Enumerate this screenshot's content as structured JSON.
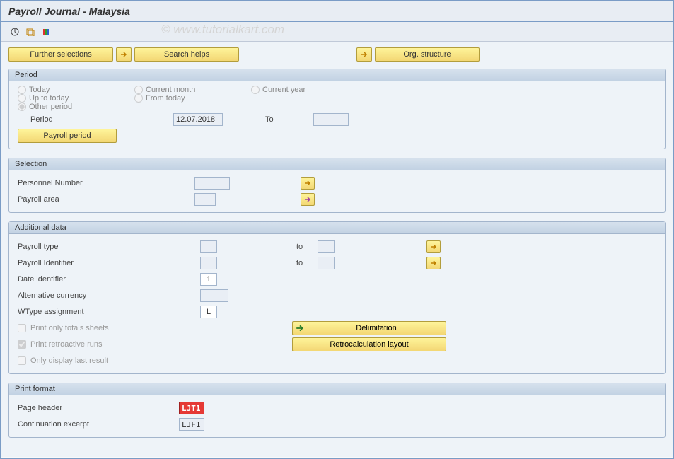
{
  "title": "Payroll Journal - Malaysia",
  "watermark": "© www.tutorialkart.com",
  "topButtons": {
    "further": "Further selections",
    "search": "Search helps",
    "org": "Org. structure"
  },
  "period": {
    "title": "Period",
    "options": {
      "today": "Today",
      "currentMonth": "Current month",
      "currentYear": "Current year",
      "upToToday": "Up to today",
      "fromToday": "From today",
      "other": "Other period"
    },
    "periodLabel": "Period",
    "periodValue": "12.07.2018",
    "toLabel": "To",
    "toValue": "",
    "payrollPeriodBtn": "Payroll period"
  },
  "selection": {
    "title": "Selection",
    "personnel": "Personnel Number",
    "payrollArea": "Payroll area"
  },
  "additional": {
    "title": "Additional data",
    "payrollType": "Payroll type",
    "payrollIdentifier": "Payroll Identifier",
    "toLabel": "to",
    "dateIdentifier": "Date identifier",
    "dateIdentifierValue": "1",
    "altCurrency": "Alternative currency",
    "wtype": "WType assignment",
    "wtypeValue": "L",
    "printTotals": "Print only totals sheets",
    "printRetro": "Print retroactive runs",
    "onlyLast": "Only display last result",
    "delimitation": "Delimitation",
    "retrocalc": "Retrocalculation layout"
  },
  "print": {
    "title": "Print format",
    "pageHeader": "Page header",
    "pageHeaderValue": "LJT1",
    "continuation": "Continuation excerpt",
    "continuationValue": "LJF1"
  }
}
